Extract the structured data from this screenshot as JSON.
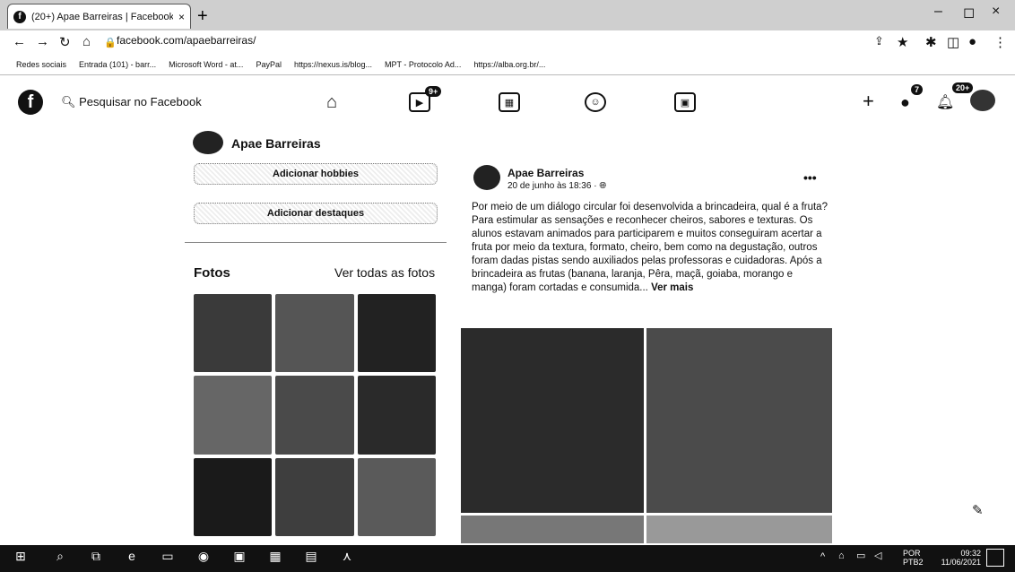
{
  "browser": {
    "tab_title": "(20+) Apae Barreiras | Facebook",
    "tab_favicon": "f",
    "url": "facebook.com/apaebarreiras/",
    "bookmarks": [
      "Redes sociais",
      "Entrada (101) - barr...",
      "Microsoft Word - at...",
      "PayPal",
      "https://nexus.is/blog...",
      "MPT - Protocolo Ad...",
      "https://alba.org.br/..."
    ]
  },
  "facebook": {
    "search_placeholder": "Pesquisar no Facebook",
    "watch_badge": "9+",
    "messenger_badge": "7",
    "notifications_badge": "20+",
    "page_name": "Apae Barreiras",
    "add_hobbies": "Adicionar hobbies",
    "add_highlights": "Adicionar destaques",
    "photos_heading": "Fotos",
    "see_all_photos": "Ver todas as fotos"
  },
  "post": {
    "author": "Apae Barreiras",
    "date": "20 de junho às 18:36 · ",
    "text": "Por meio de um diálogo circular foi desenvolvida a brincadeira, qual é a fruta? Para estimular as sensações e reconhecer cheiros, sabores e texturas.  Os alunos estavam animados para participarem e muitos conseguiram acertar a fruta por meio da textura, formato, cheiro, bem como na degustação, outros foram dadas pistas sendo auxiliados pelas professoras e cuidadoras. Após a brincadeira as frutas (banana, laranja, Pêra, maçã, goiaba, morango e manga) foram cortadas e consumida... ",
    "see_more": "Ver mais"
  },
  "taskbar": {
    "language": "POR",
    "layout": "PTB2",
    "time": "09:32",
    "date": "11/06/2021"
  }
}
